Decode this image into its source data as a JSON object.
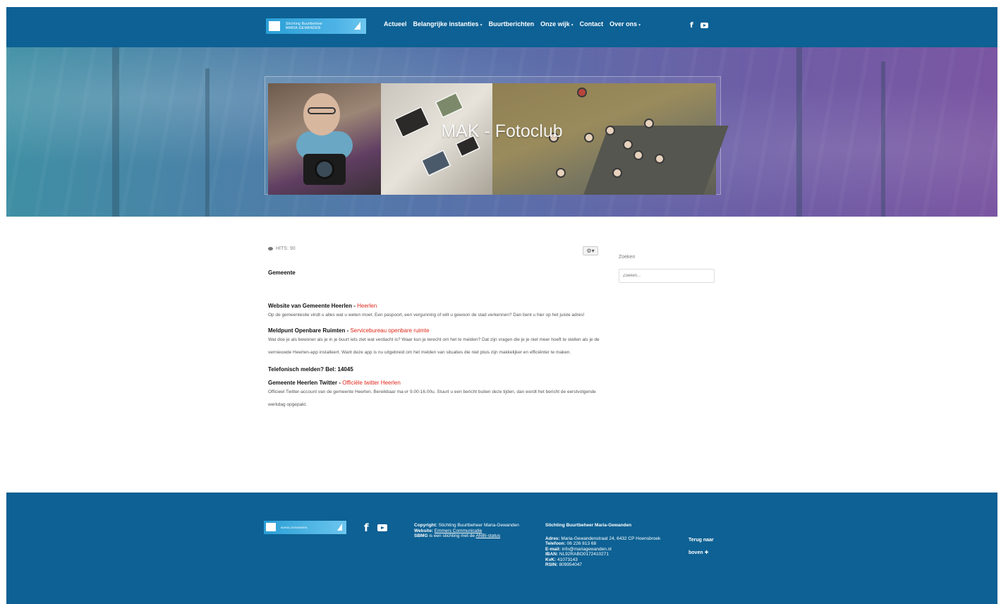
{
  "header": {
    "logo_text_line1": "Stichting Buurtbeheer",
    "logo_text_line2": "MARIA-GEWANDEN",
    "nav": [
      {
        "label": "Actueel",
        "has_caret": false
      },
      {
        "label": "Belangrijke instanties",
        "has_caret": true
      },
      {
        "label": "Buurtberichten",
        "has_caret": false
      },
      {
        "label": "Onze wijk",
        "has_caret": true
      },
      {
        "label": "Contact",
        "has_caret": false
      },
      {
        "label": "Over ons",
        "has_caret": true
      }
    ],
    "social_icons": [
      "facebook-icon",
      "youtube-icon"
    ]
  },
  "hero": {
    "title": "MAK - Fotoclub"
  },
  "article": {
    "hits": "HITS: 90",
    "heading": "Gemeente",
    "blocks": [
      {
        "title": "Website van Gemeente Heerlen",
        "separator": " - ",
        "link": "Heerlen",
        "text": "Op de gemeentesite vindt u alles wat u weten moet. Een paspoort, een vergunning of wilt u gewoon de stad verkennen? Dan bent u hier op het juiste adres!"
      },
      {
        "title": "Meldpunt Openbare Ruimten",
        "separator": " - ",
        "link": "Servicebureau openbare ruimte",
        "text": "Wat doe je als bewoner als je in je buurt iets ziet wat verdacht is? Waar kun je terecht om het te melden? Dat zijn vragen die je je niet meer hoeft te stellen als je de vernieuwde Heerlen-app installeert. Want deze app is nu uitgebreid om het melden van situaties die niet pluis zijn makkelijker en efficiënter te maken."
      },
      {
        "title": "Telefonisch melden? Bel: 14045",
        "separator": "",
        "link": "",
        "text": ""
      },
      {
        "title": "Gemeente Heerlen Twitter",
        "separator": " - ",
        "link": "Officiële twitter Heerlen",
        "text": "Officieel Twitter-account van de gemeente Heerlen. Bereikbaar ma-vr 9.00-16.00u. Stuurt u een bericht buiten deze tijden, dan wordt het bericht de eerstvolgende werkdag opgepakt."
      }
    ]
  },
  "sidebar": {
    "label": "Zoeken",
    "search_placeholder": "Zoeken..."
  },
  "footer": {
    "copyright_label": "Copyright:",
    "copyright_text": "Stichting Buurtbeheer Maria-Gewanden",
    "website_label": "Website:",
    "website_link": "Emmers Communicatie",
    "sbmg_label": "SBMG",
    "sbmg_text": "is een stichting met de",
    "sbmg_link": "ANBI-status",
    "org_name": "Stichting Buurtbeheer Maria-Gewanden",
    "address_label": "Adres:",
    "address": "Maria-Gewandenstraat 24, 6432 CP Hoensbroek",
    "phone_label": "Telefoon:",
    "phone": "06 226 813 68",
    "email_label": "E-mail:",
    "email": "info@mariagewanden.nl",
    "iban_label": "IBAN:",
    "iban": "NL92RABO0172410271",
    "kvk_label": "KvK:",
    "kvk": "41073143",
    "rsin_label": "RSIN:",
    "rsin": "809954047",
    "back_to_top_line1": "Terug naar",
    "back_to_top_line2": "boven"
  }
}
